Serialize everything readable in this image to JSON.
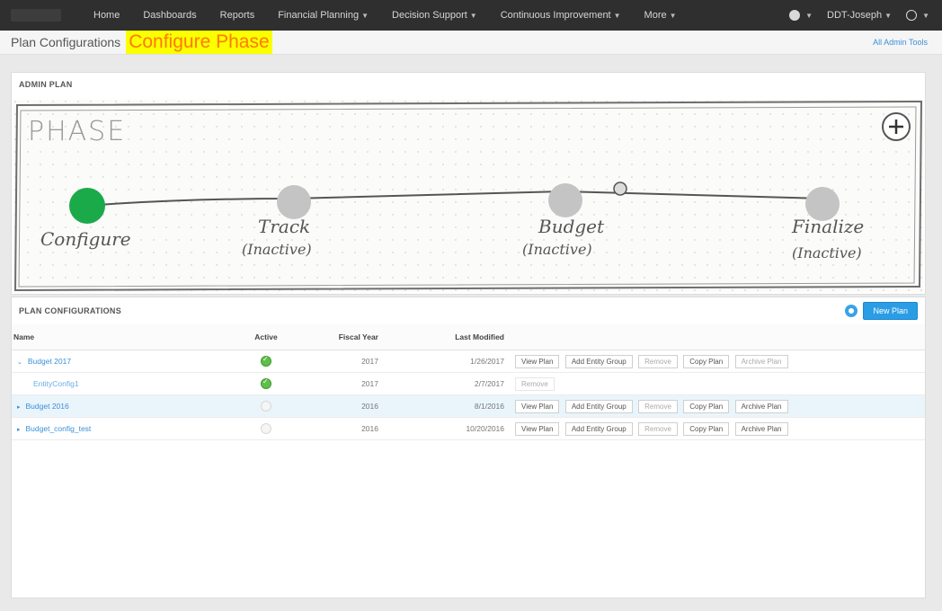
{
  "nav": {
    "items": [
      "Home",
      "Dashboards",
      "Reports",
      "Financial Planning",
      "Decision Support",
      "Continuous Improvement",
      "More"
    ],
    "user": "DDT-Joseph"
  },
  "header": {
    "title": "Plan Configurations",
    "highlight": "Configure Phase",
    "admin_link": "All Admin Tools"
  },
  "phase_panel": {
    "title": "ADMIN PLAN",
    "sketch_title": "PHASE",
    "phases": [
      {
        "label": "Configure",
        "sub": "",
        "state": "active",
        "color": "#1aaa4a"
      },
      {
        "label": "Track",
        "sub": "(Inactive)",
        "state": "inactive",
        "color": "#c4c4c4"
      },
      {
        "label": "Budget",
        "sub": "(Inactive)",
        "state": "inactive",
        "color": "#c4c4c4"
      },
      {
        "label": "Finalize",
        "sub": "(Inactive)",
        "state": "inactive",
        "color": "#c4c4c4"
      }
    ]
  },
  "configs": {
    "title": "PLAN CONFIGURATIONS",
    "new_button": "New Plan",
    "columns": [
      "Name",
      "Active",
      "Fiscal Year",
      "Last Modified"
    ],
    "rows": [
      {
        "name": "Budget 2017",
        "expand": "⌄",
        "active": true,
        "year": "2017",
        "modified": "1/26/2017",
        "buttons": [
          "View Plan",
          "Add Entity Group",
          "Remove",
          "Copy Plan",
          "Archive Plan"
        ]
      },
      {
        "name": "EntityConfig1",
        "expand": "",
        "active": true,
        "year": "2017",
        "modified": "2/7/2017",
        "buttons": [
          "Remove"
        ]
      },
      {
        "name": "Budget 2016",
        "expand": "▸",
        "active": false,
        "year": "2016",
        "modified": "8/1/2016",
        "buttons": [
          "View Plan",
          "Add Entity Group",
          "Remove",
          "Copy Plan",
          "Archive Plan"
        ]
      },
      {
        "name": "Budget_config_test",
        "expand": "▸",
        "active": false,
        "year": "2016",
        "modified": "10/20/2016",
        "buttons": [
          "View Plan",
          "Add Entity Group",
          "Remove",
          "Copy Plan",
          "Archive Plan"
        ]
      }
    ]
  }
}
